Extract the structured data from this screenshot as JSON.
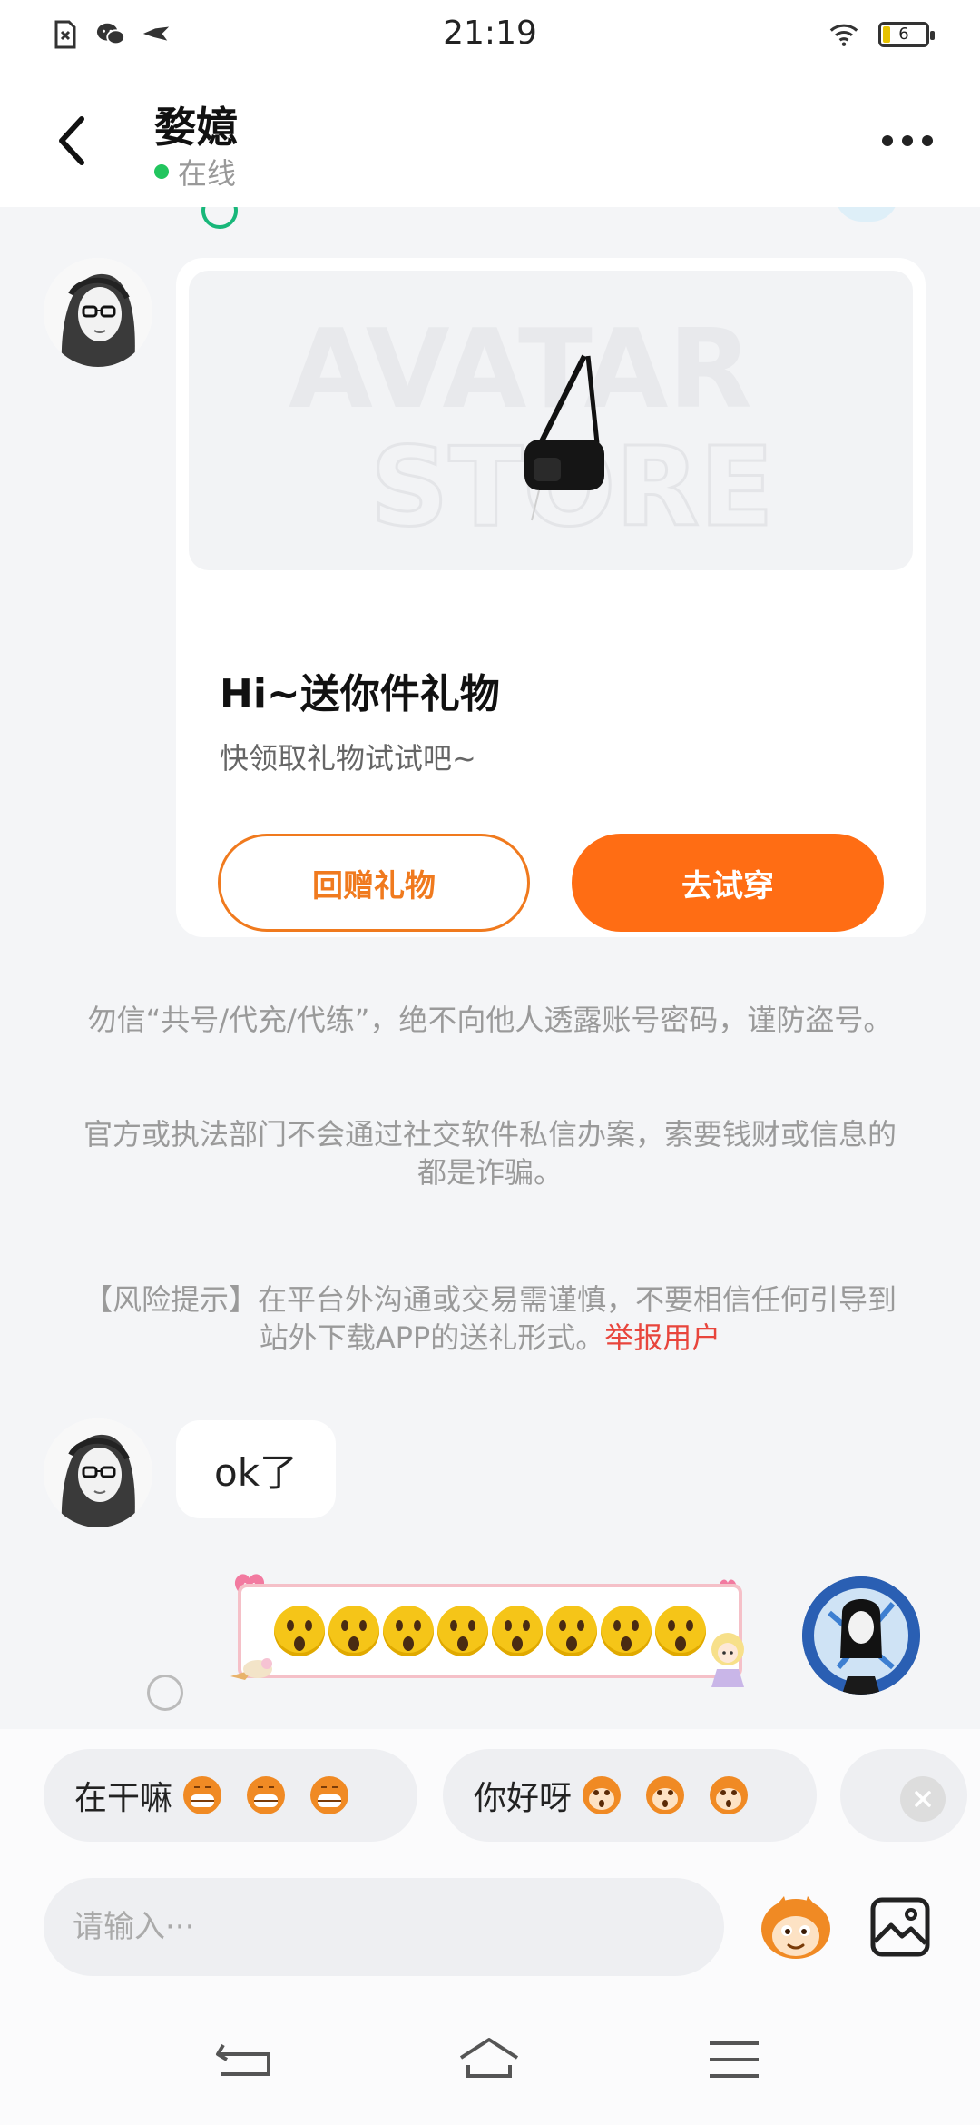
{
  "status_bar": {
    "time": "21:19",
    "battery": "6",
    "left_icons": [
      "sim-error-icon",
      "wechat-icon",
      "bird-app-icon"
    ],
    "right_icons": [
      "wifi-icon",
      "battery-icon"
    ]
  },
  "header": {
    "contact_name": "婺嬑",
    "status_text": "在线",
    "status_color": "#22c55e"
  },
  "gift_card": {
    "watermark_line1": "AVATAR",
    "watermark_line2": "STORE",
    "title": "Hi~送你件礼物",
    "subtitle": "快领取礼物试试吧~",
    "return_gift_label": "回赠礼物",
    "try_on_label": "去试穿"
  },
  "notices": {
    "notice1": "勿信“共号/代充/代练”，绝不向他人透露账号密码，谨防盗号。",
    "notice2": "官方或执法部门不会通过社交软件私信办案，索要钱财或信息的都是诈骗。",
    "risk_text": "【风险提示】在平台外沟通或交易需谨慎，不要相信任何引导到站外下载APP的送礼形式。",
    "report_link": "举报用户"
  },
  "messages": {
    "incoming_text": "ok了",
    "outgoing_emoji": "😲😲😲😲😲😲😲😲",
    "outgoing_emoji_count": 8
  },
  "quick_replies": [
    {
      "text": "在干嘛"
    },
    {
      "text": "你好呀"
    }
  ],
  "input": {
    "placeholder": "请输入···"
  },
  "colors": {
    "accent": "#ff6d14",
    "report_link": "#e8453c",
    "background": "#f4f5f7"
  }
}
